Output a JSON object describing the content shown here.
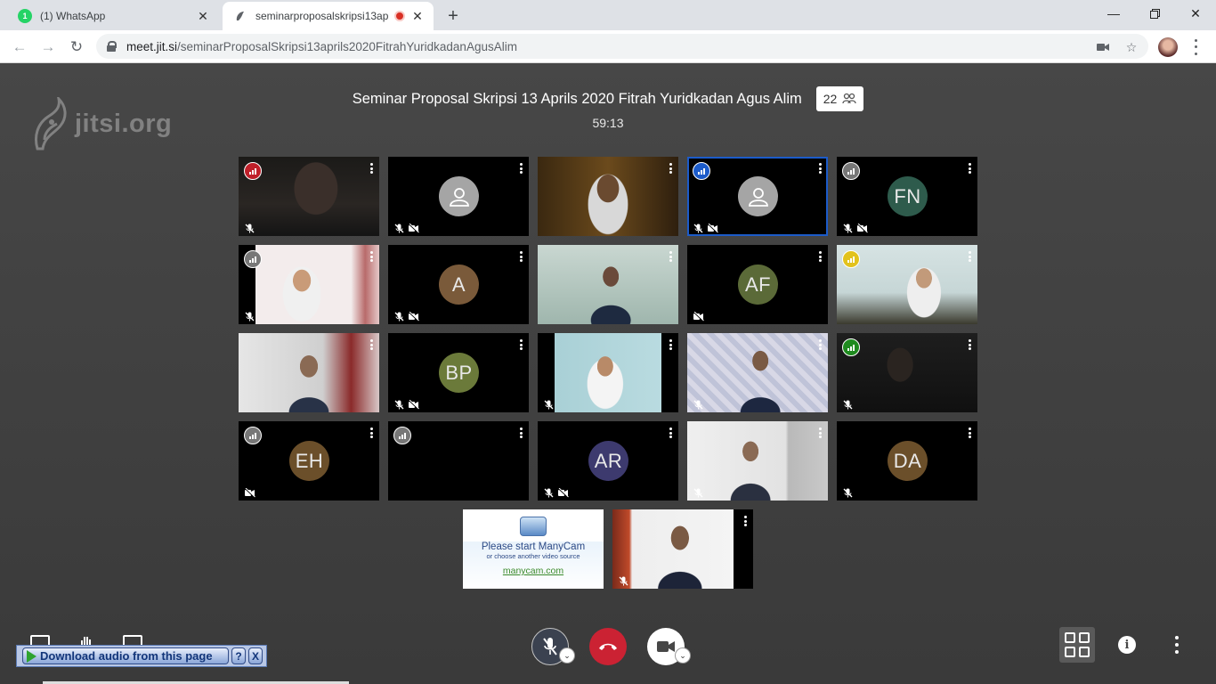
{
  "browser": {
    "tabs": [
      {
        "title": "(1) WhatsApp",
        "active": false,
        "badge": "1"
      },
      {
        "title": "seminarproposalskripsi13apr",
        "active": true
      }
    ],
    "url_host": "meet.jit.si",
    "url_path": "/seminarProposalSkripsi13aprils2020FitrahYuridkadanAgusAlim"
  },
  "meeting": {
    "watermark": "jitsi.org",
    "subject": "Seminar Proposal Skripsi 13 Aprils 2020 Fitrah Yuridkadan Agus Alim",
    "participant_count": "22",
    "timer": "59:13"
  },
  "tiles": [
    {
      "id": "t1",
      "kind": "video",
      "conn": "#c0202a",
      "muted": true,
      "cam_off": false,
      "scene": "dark-man"
    },
    {
      "id": "t2",
      "kind": "placeholder",
      "muted": true,
      "cam_off": true
    },
    {
      "id": "t3",
      "kind": "video",
      "scene": "hijab-dark"
    },
    {
      "id": "t4",
      "kind": "placeholder",
      "conn": "#1c5bc9",
      "dominant": true,
      "muted": true,
      "cam_off": true
    },
    {
      "id": "t5",
      "kind": "initials",
      "initials": "FN",
      "color": "#2e5b4c",
      "conn": "#777",
      "muted": true,
      "cam_off": true
    },
    {
      "id": "t6",
      "kind": "video",
      "conn": "#777",
      "muted": true,
      "scene": "hijab-light"
    },
    {
      "id": "t7",
      "kind": "initials",
      "initials": "A",
      "color": "#7a5a3a",
      "muted": true,
      "cam_off": true
    },
    {
      "id": "t8",
      "kind": "video",
      "scene": "boy-room"
    },
    {
      "id": "t9",
      "kind": "initials",
      "initials": "AF",
      "color": "#5b6a38",
      "cam_off": true
    },
    {
      "id": "t10",
      "kind": "video",
      "conn": "#e2c21c",
      "scene": "hijab-white"
    },
    {
      "id": "t11",
      "kind": "video",
      "scene": "man-curtain"
    },
    {
      "id": "t12",
      "kind": "initials",
      "initials": "BP",
      "color": "#6b7a3a",
      "muted": true,
      "cam_off": true
    },
    {
      "id": "t13",
      "kind": "video",
      "muted": true,
      "scene": "hijab-window"
    },
    {
      "id": "t14",
      "kind": "video",
      "muted": true,
      "scene": "man-pattern"
    },
    {
      "id": "t15",
      "kind": "video",
      "conn": "#1f8a1f",
      "muted": true,
      "scene": "dark-man2"
    },
    {
      "id": "t16",
      "kind": "initials",
      "initials": "EH",
      "color": "#6b4f2a",
      "conn": "#777",
      "cam_off": true
    },
    {
      "id": "t17",
      "kind": "blank",
      "conn": "#777"
    },
    {
      "id": "t18",
      "kind": "initials",
      "initials": "AR",
      "color": "#3d3a6e",
      "muted": true,
      "cam_off": true
    },
    {
      "id": "t19",
      "kind": "video",
      "muted": true,
      "scene": "man-office"
    },
    {
      "id": "t20",
      "kind": "initials",
      "initials": "DA",
      "color": "#6b4f2a",
      "muted": true
    },
    {
      "id": "t21",
      "kind": "manycam",
      "text1": "Please start ManyCam",
      "text2": "or choose another video source",
      "text3": "manycam.com"
    },
    {
      "id": "t22",
      "kind": "video",
      "muted": true,
      "scene": "man-glasses"
    }
  ],
  "download_bar": {
    "label": "Download audio from this page",
    "help": "?",
    "close": "X"
  }
}
